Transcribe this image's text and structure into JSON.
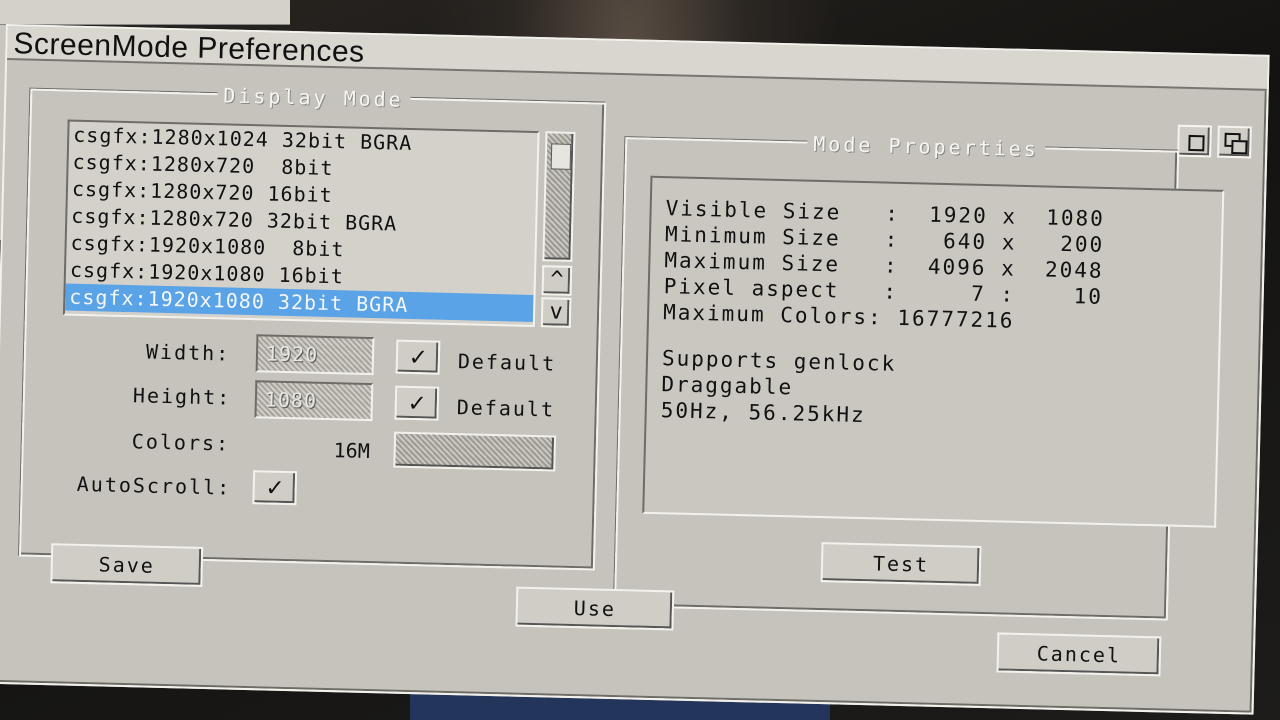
{
  "window": {
    "title": "ScreenMode Preferences"
  },
  "display_mode": {
    "label": "Display Mode",
    "modes": [
      "csgfx:1280x1024 32bit BGRA",
      "csgfx:1280x720  8bit",
      "csgfx:1280x720 16bit",
      "csgfx:1280x720 32bit BGRA",
      "csgfx:1920x1080  8bit",
      "csgfx:1920x1080 16bit",
      "csgfx:1920x1080 32bit BGRA"
    ],
    "selected_index": 6,
    "scroll_up": "^",
    "scroll_down": "v",
    "width_label": "Width:",
    "width_value": "1920",
    "height_label": "Height:",
    "height_value": "1080",
    "default_label_1": "Default",
    "default_label_2": "Default",
    "check_mark": "✓",
    "colors_label": "Colors:",
    "colors_value": "16M",
    "autoscroll_label": "AutoScroll:"
  },
  "mode_properties": {
    "label": "Mode Properties",
    "rows": [
      "Visible Size   :  1920 x  1080",
      "Minimum Size   :   640 x   200",
      "Maximum Size   :  4096 x  2048",
      "Pixel aspect   :     7 :    10",
      "Maximum Colors: 16777216"
    ],
    "features": [
      "Supports genlock",
      "Draggable",
      "50Hz, 56.25kHz"
    ],
    "test_button": "Test"
  },
  "buttons": {
    "save": "Save",
    "use": "Use",
    "cancel": "Cancel"
  }
}
